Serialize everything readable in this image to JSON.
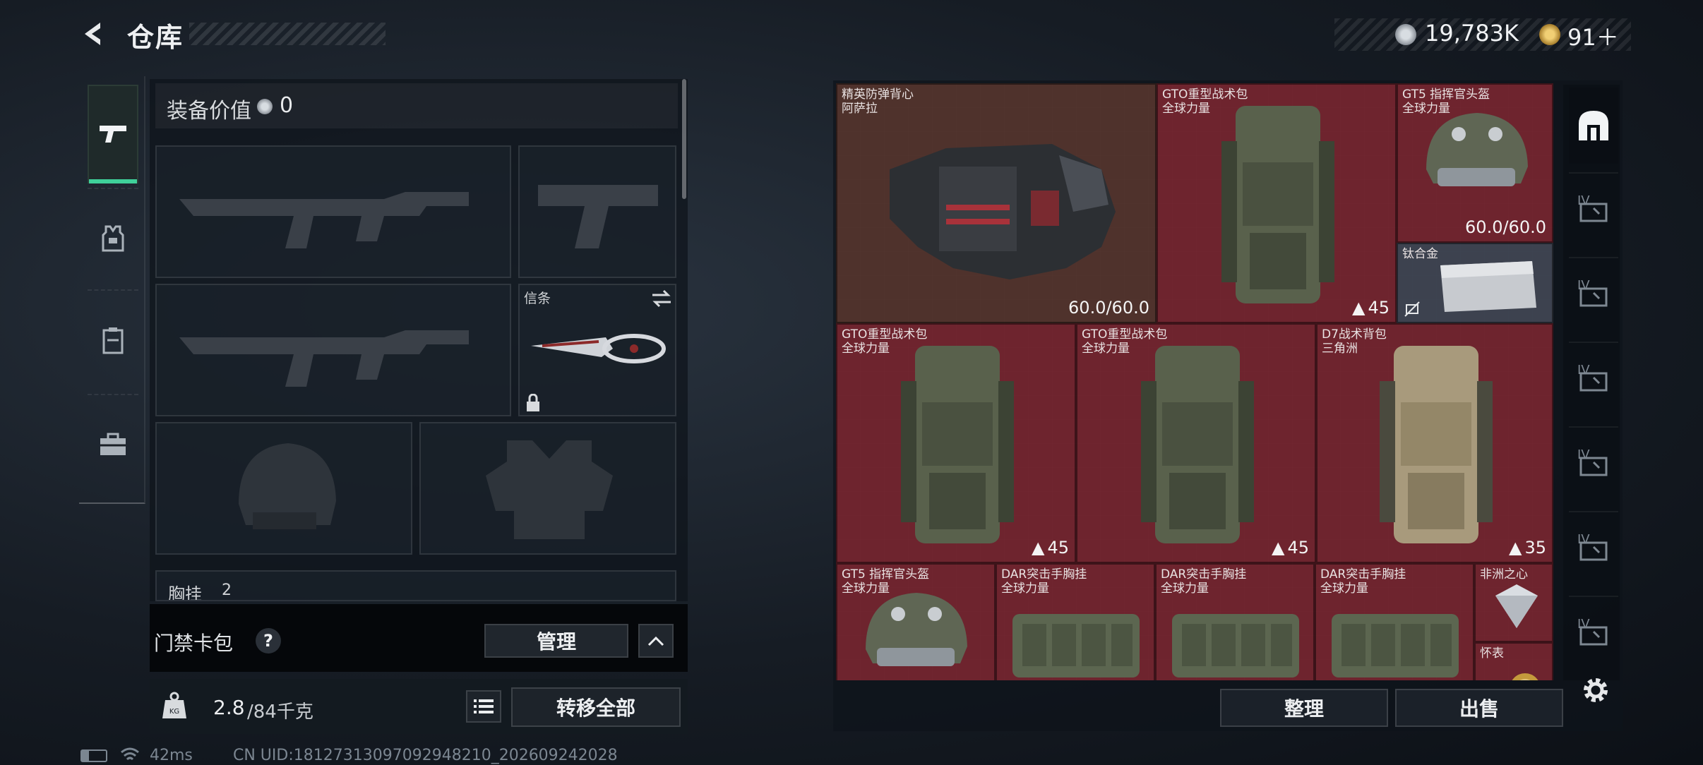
{
  "header": {
    "title": "仓库",
    "currency": [
      {
        "icon": "silver-coin-icon",
        "value": "19,783K"
      },
      {
        "icon": "gold-coin-icon",
        "value": "91＋"
      }
    ]
  },
  "left_tabs": [
    {
      "icon": "pistol-icon",
      "active": true
    },
    {
      "icon": "vest-icon",
      "active": false
    },
    {
      "icon": "rig-icon",
      "active": false
    },
    {
      "icon": "toolbox-icon",
      "active": false
    }
  ],
  "loadout": {
    "value_label": "装备价值",
    "value_amount": "0",
    "slots": {
      "primary_weapon": "",
      "sidearm": "",
      "secondary_weapon": "",
      "melee_label": "信条",
      "helmet": "",
      "armor": "",
      "chest_rig_label": "胸挂",
      "chest_rig_count": "2"
    }
  },
  "keycard": {
    "label": "门禁卡包",
    "help": "?",
    "manage_label": "管理"
  },
  "weight": {
    "current": "2.8",
    "max": "/84千克",
    "transfer_label": "转移全部"
  },
  "status": {
    "ping": "42ms",
    "uid": "CN UID:1812731309709294821​0_202609242028"
  },
  "stash_items": [
    {
      "name": "精英防弹背心",
      "sub": "阿萨拉",
      "value": "60.0/60.0"
    },
    {
      "name": "GTO重型战术包",
      "sub": "全球力量",
      "capacity": "45"
    },
    {
      "name": "GT5 指挥官头盔",
      "sub": "全球力量",
      "value": "60.0/60.0"
    },
    {
      "name": "钛合金",
      "sub": ""
    },
    {
      "name": "GTO重型战术包",
      "sub": "全球力量",
      "capacity": "45"
    },
    {
      "name": "GTO重型战术包",
      "sub": "全球力量",
      "capacity": "45"
    },
    {
      "name": "D7战术背包",
      "sub": "三角洲",
      "capacity": "35"
    },
    {
      "name": "GT5 指挥官头盔",
      "sub": "全球力量"
    },
    {
      "name": "DAR突击手胸挂",
      "sub": "全球力量"
    },
    {
      "name": "DAR突击手胸挂",
      "sub": "全球力量"
    },
    {
      "name": "DAR突击手胸挂",
      "sub": "全球力量"
    },
    {
      "name": "非洲之心",
      "sub": ""
    },
    {
      "name": "怀表",
      "sub": ""
    }
  ],
  "right_tabs": [
    "IV",
    "IV",
    "IV",
    "IV",
    "IV",
    "IV"
  ],
  "actions": {
    "organize_label": "整理",
    "sell_label": "出售"
  },
  "colors": {
    "accent_green": "#3fd09a",
    "stash_red": "#782630",
    "panel_dark": "#0e131a"
  }
}
